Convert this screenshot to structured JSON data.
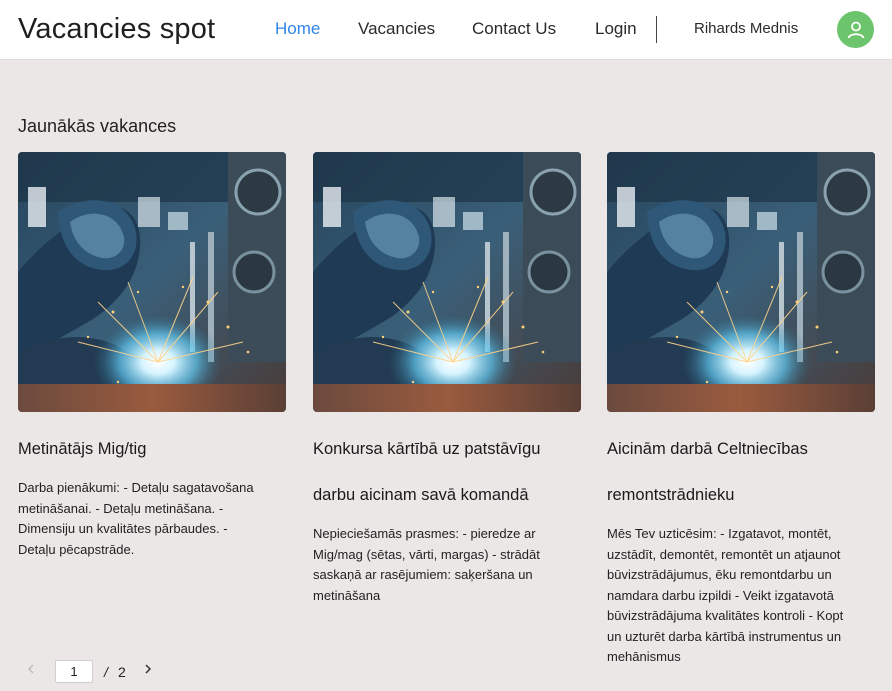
{
  "header": {
    "brand": "Vacancies spot",
    "nav": [
      {
        "label": "Home",
        "active": true
      },
      {
        "label": "Vacancies",
        "active": false
      },
      {
        "label": "Contact Us",
        "active": false
      },
      {
        "label": "Login",
        "active": false
      }
    ],
    "user_name": "Rihards Mednis",
    "avatar_icon": "user-icon",
    "accent_color": "#2f86e6",
    "avatar_color": "#6cc46c"
  },
  "main": {
    "section_title": "Jaunākās vakances",
    "cards": [
      {
        "title_lines": [
          "Metinātājs Mig/tig"
        ],
        "description_lines": [
          "Darba pienākumi: - Detaļu sagatavošana",
          "metināšanai. - Detaļu metināšana. -",
          "Dimensiju un kvalitātes pārbaudes. -",
          "Detaļu pēcapstrāde."
        ],
        "image": "welder-photo"
      },
      {
        "title_lines": [
          "Konkursa kārtībā uz patstāvīgu",
          "darbu aicinam savā komandā"
        ],
        "description_lines": [
          "Nepieciešamās prasmes: - pieredze ar",
          "Mig/mag (sētas, vārti, margas) - strādāt",
          "saskaņā ar rasējumiem: saķeršana un",
          "metināšana"
        ],
        "image": "welder-photo"
      },
      {
        "title_lines": [
          "Aicinām darbā Celtniecības",
          "remontstrādnieku"
        ],
        "description_lines": [
          "Mēs Tev uzticēsim: - Izgatavot, montēt,",
          "uzstādīt, demontēt, remontēt un atjaunot",
          "būvizstrādājumus, ēku remontdarbu un",
          "namdara darbu izpildi - Veikt izgatavotā",
          "būvizstrādājuma kvalitātes kontroli - Kopt",
          "un uzturēt darba kārtībā instrumentus un",
          "mehānismus"
        ],
        "image": "welder-photo"
      }
    ]
  },
  "pagination": {
    "prev_icon": "chevron-left-icon",
    "current_page": "1",
    "separator": "/",
    "total_pages": "2",
    "next_icon": "chevron-right-icon"
  }
}
